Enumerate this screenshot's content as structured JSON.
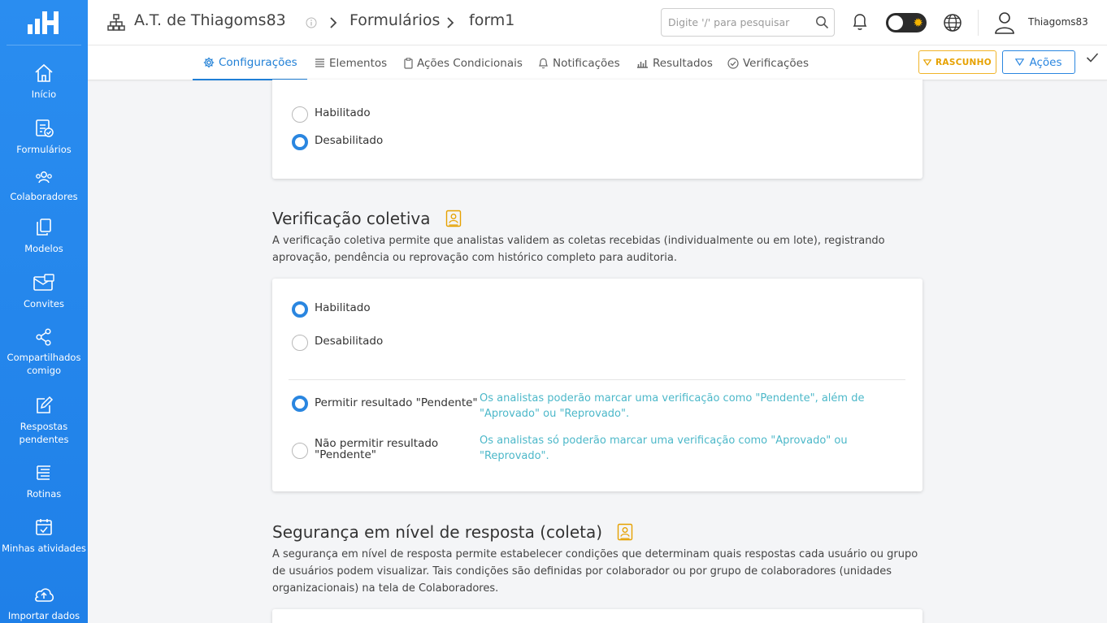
{
  "sidebar": {
    "items": [
      {
        "label": "Início",
        "icon": "home-icon"
      },
      {
        "label": "Formulários",
        "icon": "forms-icon"
      },
      {
        "label": "Colaboradores",
        "icon": "users-icon"
      },
      {
        "label": "Modelos",
        "icon": "templates-icon"
      },
      {
        "label": "Convites",
        "icon": "invites-icon"
      },
      {
        "label": "Compartilhados comigo",
        "icon": "share-icon"
      },
      {
        "label": "Respostas pendentes",
        "icon": "edit-icon"
      },
      {
        "label": "Rotinas",
        "icon": "routines-icon"
      },
      {
        "label": "Minhas atividades",
        "icon": "calendar-check-icon"
      },
      {
        "label": "Importar dados",
        "icon": "cloud-upload-icon"
      }
    ]
  },
  "header": {
    "org": "A.T. de Thiagoms83",
    "crumb1": "Formulários",
    "crumb2": "form1",
    "search_placeholder": "Digite '/' para pesquisar",
    "username": "Thiagoms83"
  },
  "tabs": [
    {
      "label": "Configurações",
      "icon": "gear-icon"
    },
    {
      "label": "Elementos",
      "icon": "list-icon"
    },
    {
      "label": "Ações Condicionais",
      "icon": "clipboard-icon"
    },
    {
      "label": "Notificações",
      "icon": "bell-icon"
    },
    {
      "label": "Resultados",
      "icon": "chart-icon"
    },
    {
      "label": "Verificações",
      "icon": "check-circle-icon"
    }
  ],
  "toolbar": {
    "draft_label": "RASCUNHO",
    "actions_label": "Ações"
  },
  "card1": {
    "opt_enabled": "Habilitado",
    "opt_disabled": "Desabilitado",
    "selected": "disabled"
  },
  "verification": {
    "title": "Verificação coletiva",
    "description": "A verificação coletiva permite que analistas validem as coletas recebidas (individualmente ou em lote), registrando aprovação, pendência ou reprovação com histórico completo para auditoria.",
    "opt_enabled": "Habilitado",
    "opt_disabled": "Desabilitado",
    "selected": "enabled",
    "allow_pending": "Permitir resultado \"Pendente\"",
    "allow_pending_hint": "Os analistas poderão marcar uma verificação como \"Pendente\", além de \"Aprovado\" ou \"Reprovado\".",
    "deny_pending": "Não permitir resultado \"Pendente\"",
    "deny_pending_hint": "Os analistas só poderão marcar uma verificação como \"Aprovado\" ou \"Reprovado\".",
    "pending_selected": "allow"
  },
  "security": {
    "title": "Segurança em nível de resposta (coleta)",
    "description": "A segurança em nível de resposta permite estabelecer condições que determinam quais respostas cada usuário ou grupo de usuários podem visualizar. Tais condições são definidas por colaborador ou por grupo de colaboradores (unidades organizacionais) na tela de Colaboradores."
  },
  "colors": {
    "primary": "#2a86e0",
    "sidebar": "#2a8df0",
    "draft": "#f0b429",
    "hint": "#4cb8c9"
  }
}
